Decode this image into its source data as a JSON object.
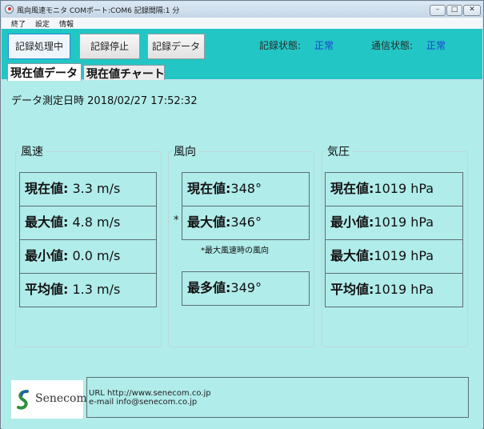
{
  "window": {
    "title": "風向風速モニタ COMポート:COM6 記録間隔:1 分",
    "controls": {
      "minimize": "–",
      "maximize": "□",
      "close": "✕"
    }
  },
  "menu": [
    "終了",
    "設定",
    "情報"
  ],
  "toolbar": {
    "buttons": [
      "記録処理中",
      "記録停止",
      "記録データ"
    ],
    "record_status_label": "記録状態:",
    "record_status_value": "正常",
    "comm_status_label": "通信状態:",
    "comm_status_value": "正常"
  },
  "tabs": [
    "現在値データ",
    "現在値チャート"
  ],
  "measurement": {
    "label": "データ測定日時",
    "datetime": "2018/02/27 17:52:32"
  },
  "wind_speed": {
    "title": "風速",
    "rows": [
      {
        "label": "現在値:",
        "value": "3.3 m/s"
      },
      {
        "label": "最大値:",
        "value": "4.8 m/s"
      },
      {
        "label": "最小値:",
        "value": "0.0 m/s"
      },
      {
        "label": "平均値:",
        "value": "1.3 m/s"
      }
    ]
  },
  "wind_direction": {
    "title": "風向",
    "current": {
      "label": "現在値:",
      "value": "348°"
    },
    "max": {
      "label": "最大値:",
      "value": "346°",
      "marker": "*"
    },
    "note": "*最大風速時の風向",
    "mode": {
      "label": "最多値:",
      "value": "349°"
    }
  },
  "pressure": {
    "title": "気圧",
    "rows": [
      {
        "label": "現在値:",
        "value": "1019 hPa"
      },
      {
        "label": "最小値:",
        "value": "1019 hPa"
      },
      {
        "label": "最大値:",
        "value": "1019 hPa"
      },
      {
        "label": "平均値:",
        "value": "1019 hPa"
      }
    ]
  },
  "footer": {
    "logo_text": "Senecom",
    "url_line": "URL http://www.senecom.co.jp",
    "email_line": "e-mail  info@senecom.co.jp"
  },
  "colors": {
    "toolbar_bg": "#22c6c4",
    "content_bg": "#b0ecea",
    "status_value": "#1a3fd0"
  }
}
